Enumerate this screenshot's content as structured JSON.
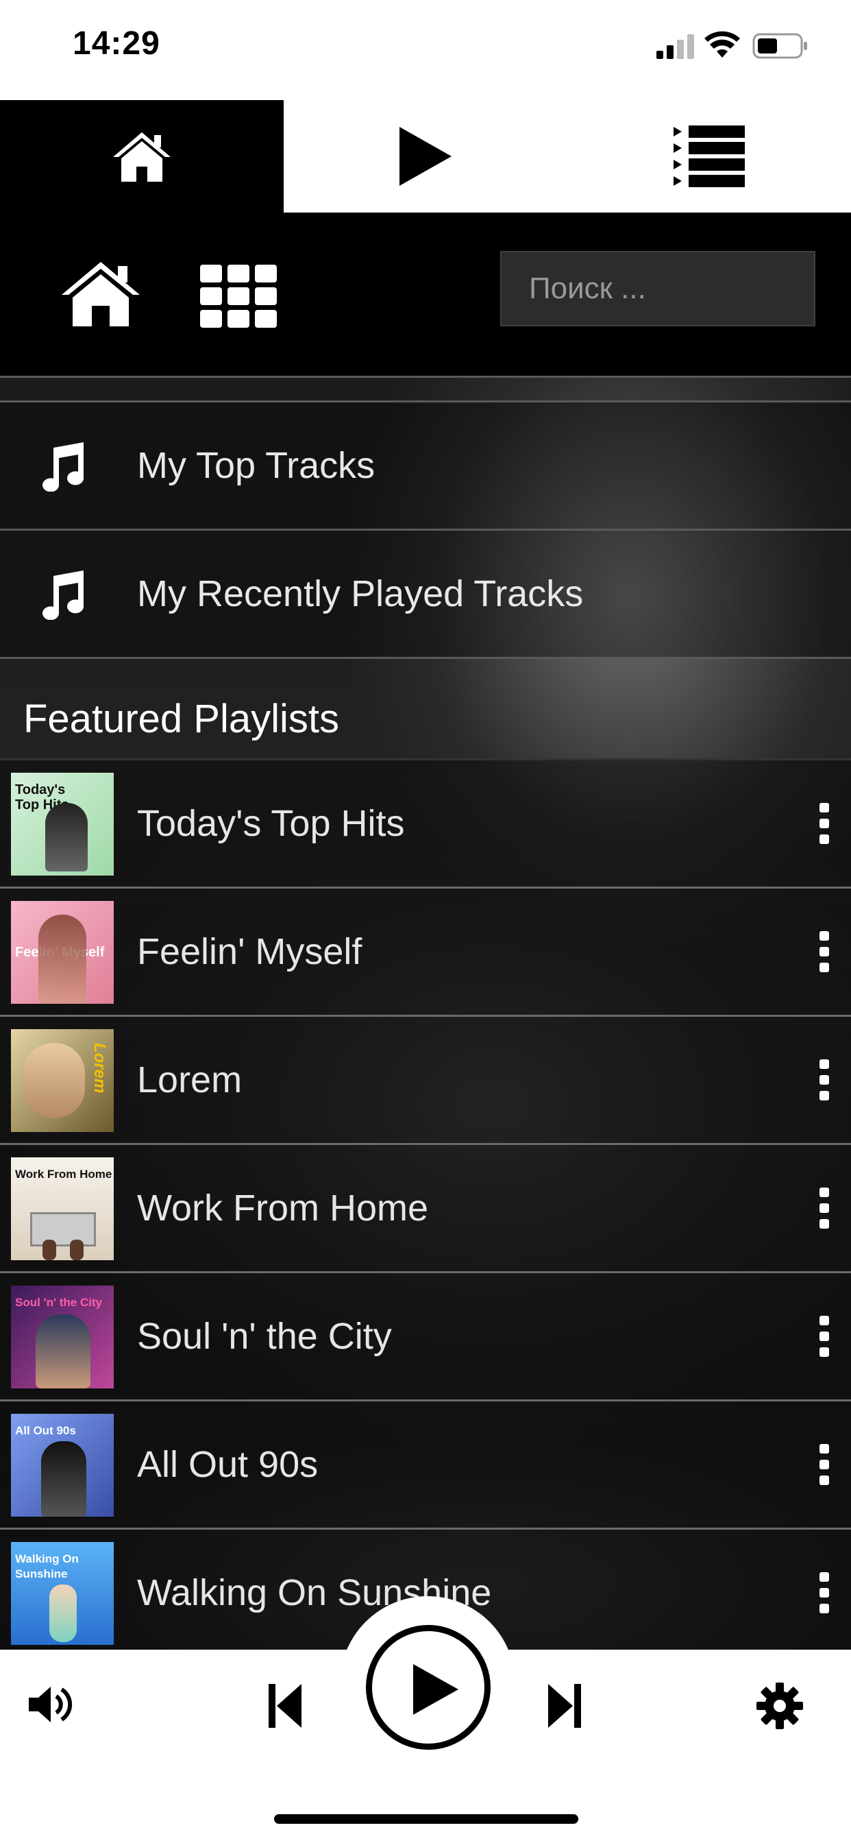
{
  "status_bar": {
    "time": "14:29"
  },
  "tabs": [
    {
      "id": "home",
      "icon": "home-icon",
      "active": true
    },
    {
      "id": "now-playing",
      "icon": "play-icon",
      "active": false
    },
    {
      "id": "queue",
      "icon": "queue-list-icon",
      "active": false
    }
  ],
  "toolbar": {
    "home_icon": "home-icon",
    "grid_icon": "grid-icon",
    "search_placeholder": "Поиск ..."
  },
  "library_links": [
    {
      "label": "My Top Tracks",
      "icon": "music-note-icon"
    },
    {
      "label": "My Recently Played Tracks",
      "icon": "music-note-icon"
    }
  ],
  "featured": {
    "title": "Featured Playlists",
    "playlists": [
      {
        "title": "Today's Top Hits",
        "cover_text": "Today's\nTop Hits",
        "cover_colors": [
          "#c9ecd0",
          "#9fd9a8"
        ]
      },
      {
        "title": "Feelin' Myself",
        "cover_text": "Feelin' Myself",
        "cover_colors": [
          "#f2a7bf",
          "#e07f98"
        ]
      },
      {
        "title": "Lorem",
        "cover_text": "Lorem",
        "cover_colors": [
          "#d8c98a",
          "#6b5a2e"
        ]
      },
      {
        "title": "Work From Home",
        "cover_text": "Work From Home",
        "cover_colors": [
          "#f3eee6",
          "#d9cdbb"
        ]
      },
      {
        "title": "Soul 'n' the City",
        "cover_text": "Soul 'n' the City",
        "cover_colors": [
          "#b23d8f",
          "#3b1b5a"
        ]
      },
      {
        "title": "All Out 90s",
        "cover_text": "All Out 90s",
        "cover_colors": [
          "#6e8fe0",
          "#3a4fa8"
        ]
      },
      {
        "title": "Walking On Sunshine",
        "cover_text": "Walking On\nSunshine",
        "cover_colors": [
          "#4aa3f0",
          "#2a6fd0"
        ]
      }
    ]
  },
  "player": {
    "volume_icon": "volume-icon",
    "prev_icon": "skip-previous-icon",
    "play_icon": "play-icon",
    "next_icon": "skip-next-icon",
    "settings_icon": "settings-gear-icon"
  }
}
